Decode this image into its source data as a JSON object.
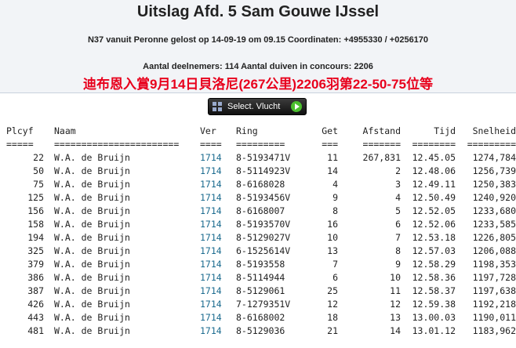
{
  "header": {
    "title": "Uitslag Afd. 5 Sam Gouwe IJssel",
    "release_line": "N37 vanuit Peronne gelost op 14-09-19 om 09.15 Coordinaten: +4955330 / +0256170",
    "counts_line": "Aantal deelnemers: 114 Aantal duiven in concours: 2206",
    "chinese_line": "迪布恩入賞9月14日貝洛尼(267公里)2206羽第22-50-75位等"
  },
  "select_button": {
    "label": "Select. Vlucht",
    "icon": "grid-icon",
    "arrow_icon": "green-arrow-icon"
  },
  "table": {
    "columns": [
      "Plcyf",
      "Naam",
      "Ver",
      "Ring",
      "Get",
      "Afstand",
      "Tijd",
      "Snelheid"
    ],
    "underline": [
      "=====",
      "=======================",
      "====",
      "=========",
      "===",
      "=======",
      "========",
      "========="
    ],
    "rows": [
      [
        "22",
        "W.A. de Bruijn",
        "1714",
        "8-5193471V",
        "11",
        "267,831",
        "12.45.05",
        "1274,784"
      ],
      [
        "50",
        "W.A. de Bruijn",
        "1714",
        "8-5114923V",
        "14",
        "2",
        "12.48.06",
        "1256,739"
      ],
      [
        "75",
        "W.A. de Bruijn",
        "1714",
        "8-6168028",
        "4",
        "3",
        "12.49.11",
        "1250,383"
      ],
      [
        "125",
        "W.A. de Bruijn",
        "1714",
        "8-5193456V",
        "9",
        "4",
        "12.50.49",
        "1240,920"
      ],
      [
        "156",
        "W.A. de Bruijn",
        "1714",
        "8-6168007",
        "8",
        "5",
        "12.52.05",
        "1233,680"
      ],
      [
        "158",
        "W.A. de Bruijn",
        "1714",
        "8-5193570V",
        "16",
        "6",
        "12.52.06",
        "1233,585"
      ],
      [
        "194",
        "W.A. de Bruijn",
        "1714",
        "8-5129027V",
        "10",
        "7",
        "12.53.18",
        "1226,805"
      ],
      [
        "325",
        "W.A. de Bruijn",
        "1714",
        "6-1525614V",
        "13",
        "8",
        "12.57.03",
        "1206,088"
      ],
      [
        "379",
        "W.A. de Bruijn",
        "1714",
        "8-5193558",
        "7",
        "9",
        "12.58.29",
        "1198,353"
      ],
      [
        "386",
        "W.A. de Bruijn",
        "1714",
        "8-5114944",
        "6",
        "10",
        "12.58.36",
        "1197,728"
      ],
      [
        "387",
        "W.A. de Bruijn",
        "1714",
        "8-5129061",
        "25",
        "11",
        "12.58.37",
        "1197,638"
      ],
      [
        "426",
        "W.A. de Bruijn",
        "1714",
        "7-1279351V",
        "12",
        "12",
        "12.59.38",
        "1192,218"
      ],
      [
        "443",
        "W.A. de Bruijn",
        "1714",
        "8-6168002",
        "18",
        "13",
        "13.00.03",
        "1190,011"
      ],
      [
        "481",
        "W.A. de Bruijn",
        "1714",
        "8-5129036",
        "21",
        "14",
        "13.01.12",
        "1183,962"
      ]
    ]
  }
}
